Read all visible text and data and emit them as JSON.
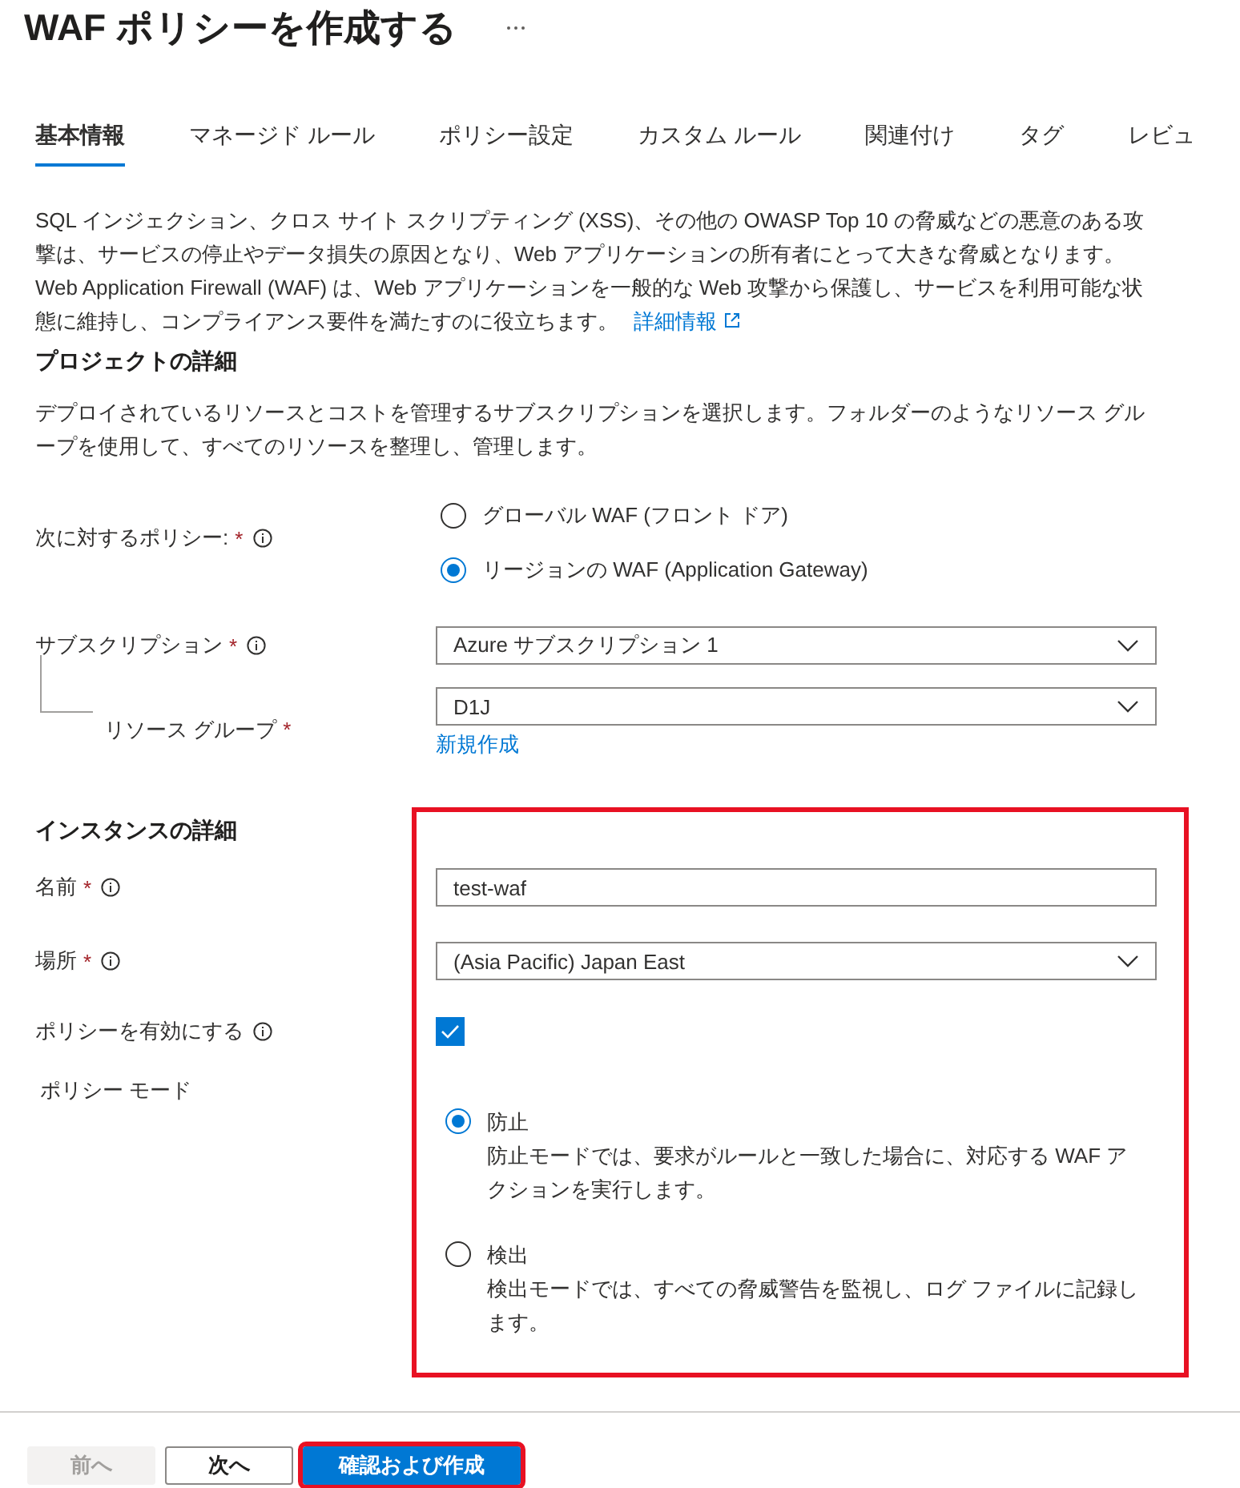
{
  "title": "WAF ポリシーを作成する",
  "tabs": [
    {
      "label": "基本情報",
      "selected": true
    },
    {
      "label": "マネージド ルール",
      "selected": false
    },
    {
      "label": "ポリシー設定",
      "selected": false
    },
    {
      "label": "カスタム ルール",
      "selected": false
    },
    {
      "label": "関連付け",
      "selected": false
    },
    {
      "label": "タグ",
      "selected": false
    },
    {
      "label": "レビュ",
      "selected": false
    }
  ],
  "description": {
    "text": "SQL インジェクション、クロス サイト スクリプティング (XSS)、その他の OWASP Top 10 の脅威などの悪意のある攻撃は、サービスの停止やデータ損失の原因となり、Web アプリケーションの所有者にとって大きな脅威となります。Web Application Firewall (WAF) は、Web アプリケーションを一般的な Web 攻撃から保護し、サービスを利用可能な状態に維持し、コンプライアンス要件を満たすのに役立ちます。",
    "link": "詳細情報"
  },
  "project_section": {
    "heading": "プロジェクトの詳細",
    "text": "デプロイされているリソースとコストを管理するサブスクリプションを選択します。フォルダーのようなリソース グループを使用して、すべてのリソースを整理し、管理します。",
    "policy_for": {
      "label": "次に対するポリシー:",
      "required_mark": "*",
      "info": true,
      "options": [
        {
          "label": "グローバル WAF (フロント ドア)",
          "selected": false
        },
        {
          "label": "リージョンの WAF (Application Gateway)",
          "selected": true
        }
      ]
    },
    "subscription": {
      "label": "サブスクリプション",
      "required_mark": "*",
      "info": true,
      "value": "Azure サブスクリプション 1"
    },
    "resource_group": {
      "label": "リソース グループ",
      "required_mark": "*",
      "info": false,
      "value": "D1J",
      "link": "新規作成"
    }
  },
  "instance_section": {
    "heading": "インスタンスの詳細",
    "highlighted": true,
    "name": {
      "label": "名前",
      "required_mark": "*",
      "info": true,
      "value": "test-waf"
    },
    "location": {
      "label": "場所",
      "required_mark": "*",
      "info": true,
      "value": "(Asia Pacific) Japan East"
    },
    "enable_policy": {
      "label": "ポリシーを有効にする",
      "info": true,
      "checked": true
    },
    "policy_mode": {
      "label": "ポリシー モード",
      "info": false,
      "options": [
        {
          "label": "防止",
          "description": "防止モードでは、要求がルールと一致した場合に、対応する WAF アクションを実行します。",
          "selected": true
        },
        {
          "label": "検出",
          "description": "検出モードでは、すべての脅威警告を監視し、ログ ファイルに記録します。",
          "selected": false
        }
      ]
    }
  },
  "footer": {
    "buttons": [
      {
        "label": "前へ",
        "kind": "secondary",
        "disabled": true,
        "highlighted": false
      },
      {
        "label": "次へ",
        "kind": "secondary",
        "disabled": false,
        "highlighted": false
      },
      {
        "label": "確認および作成",
        "kind": "primary",
        "disabled": false,
        "highlighted": true
      }
    ]
  }
}
